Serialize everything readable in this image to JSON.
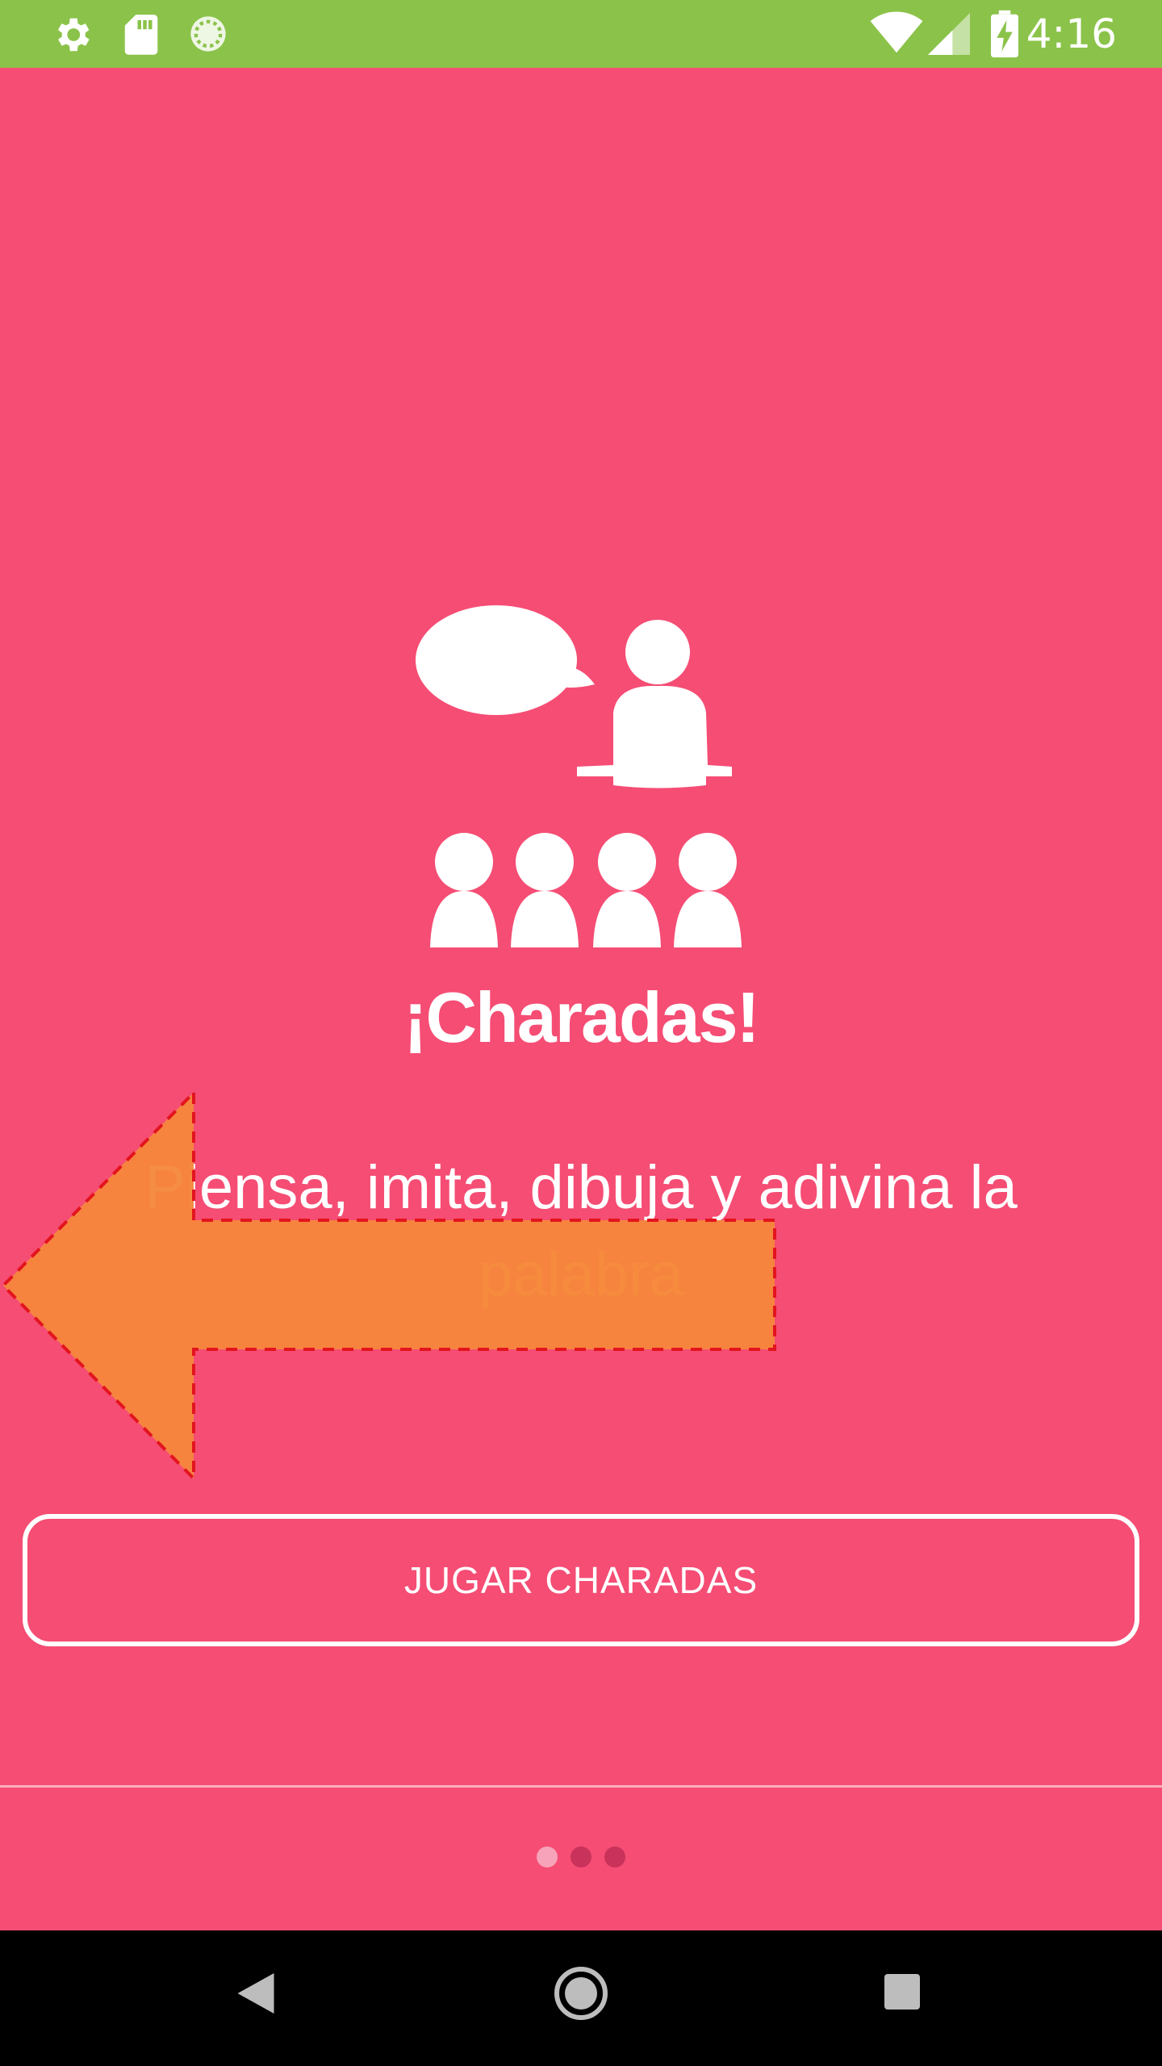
{
  "status_bar": {
    "time": "4:16",
    "left_icons": [
      "settings-icon",
      "sd-card-icon",
      "sync-icon"
    ],
    "right_icons": [
      "wifi-icon",
      "signal-icon",
      "battery-charging-icon"
    ],
    "background": "#8BC34A"
  },
  "main": {
    "background": "#F54D74",
    "illustration_icon": "group-speaker-icon",
    "title": "¡Charadas!",
    "subtitle_part1": "Piensa, imita, dibuja y adivina la",
    "subtitle_part2": "palabra",
    "accent_color": "#FFD66E",
    "play_button_label": "JUGAR CHARADAS"
  },
  "coach_mark": {
    "shape": "left-arrow",
    "fill": "#F5873B",
    "border": "#E3141E"
  },
  "pager": {
    "pages": 3,
    "active_index": 0
  },
  "nav_bar": {
    "buttons": [
      "back-icon",
      "home-icon",
      "recents-icon"
    ]
  }
}
